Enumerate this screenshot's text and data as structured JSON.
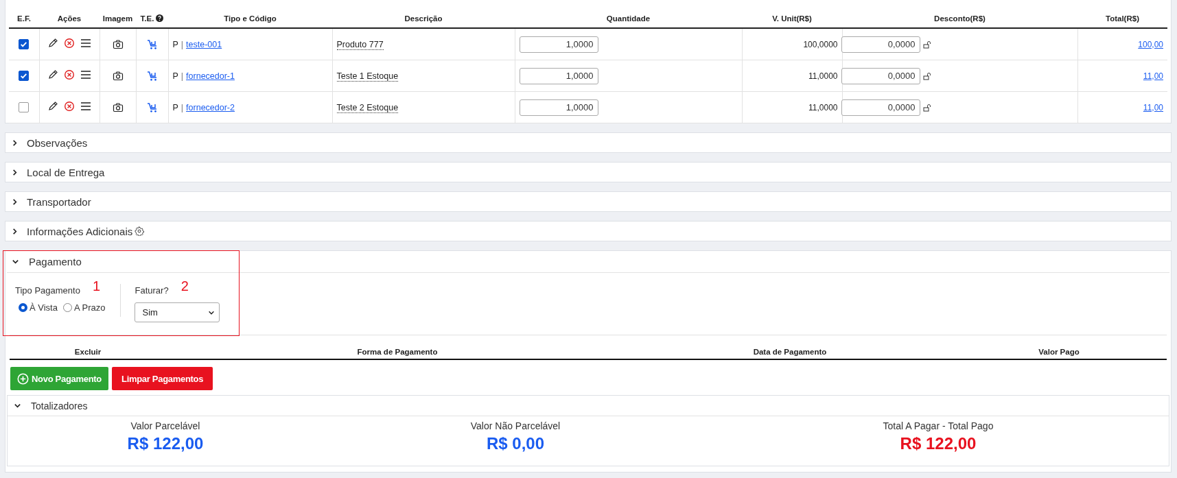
{
  "items_table": {
    "columns": [
      "E.F.",
      "Ações",
      "Imagem",
      "T.E.",
      "Tipo e Código",
      "Descrição",
      "Quantidade",
      "V. Unit(R$)",
      "Desconto(R$)",
      "Total(R$)"
    ],
    "rows": [
      {
        "checked": true,
        "type": "P",
        "separator": "|",
        "code": "teste-001",
        "description": "Produto 777",
        "quantity": "1,0000",
        "unit_value": "100,0000",
        "discount": "0,0000",
        "total": "100,00"
      },
      {
        "checked": true,
        "type": "P",
        "separator": "|",
        "code": "fornecedor-1",
        "description": "Teste 1 Estoque",
        "quantity": "1,0000",
        "unit_value": "11,0000",
        "discount": "0,0000",
        "total": "11,00"
      },
      {
        "checked": false,
        "type": "P",
        "separator": "|",
        "code": "fornecedor-2",
        "description": "Teste 2 Estoque",
        "quantity": "1,0000",
        "unit_value": "11,0000",
        "discount": "0,0000",
        "total": "11,00"
      }
    ]
  },
  "sections": [
    {
      "title": "Observações",
      "expanded": false,
      "settings": false
    },
    {
      "title": "Local de Entrega",
      "expanded": false,
      "settings": false
    },
    {
      "title": "Transportador",
      "expanded": false,
      "settings": false
    },
    {
      "title": "Informações Adicionais",
      "expanded": false,
      "settings": true
    }
  ],
  "payment": {
    "title": "Pagamento",
    "expanded": true,
    "tipo_label": "Tipo Pagamento",
    "tipo_marker": "1",
    "options": [
      {
        "label": "À Vista",
        "selected": true
      },
      {
        "label": "A Prazo",
        "selected": false
      }
    ],
    "faturar_label": "Faturar?",
    "faturar_marker": "2",
    "faturar_value": "Sim",
    "columns": [
      "Excluir",
      "Forma de Pagamento",
      "Data de Pagamento",
      "Valor Pago"
    ],
    "buttons": [
      {
        "label": "Novo Pagamento",
        "kind": "add"
      },
      {
        "label": "Limpar Pagamentos",
        "kind": "clear"
      }
    ]
  },
  "totals": {
    "title": "Totalizadores",
    "expanded": true,
    "items": [
      {
        "label": "Valor Parcelável",
        "value": "R$ 122,00",
        "color": "#1a5cf0"
      },
      {
        "label": "Valor Não Parcelável",
        "value": "R$ 0,00",
        "color": "#1a5cf0"
      },
      {
        "label": "Total A Pagar - Total Pago",
        "value": "R$ 122,00",
        "color": "#e8121f"
      }
    ]
  }
}
